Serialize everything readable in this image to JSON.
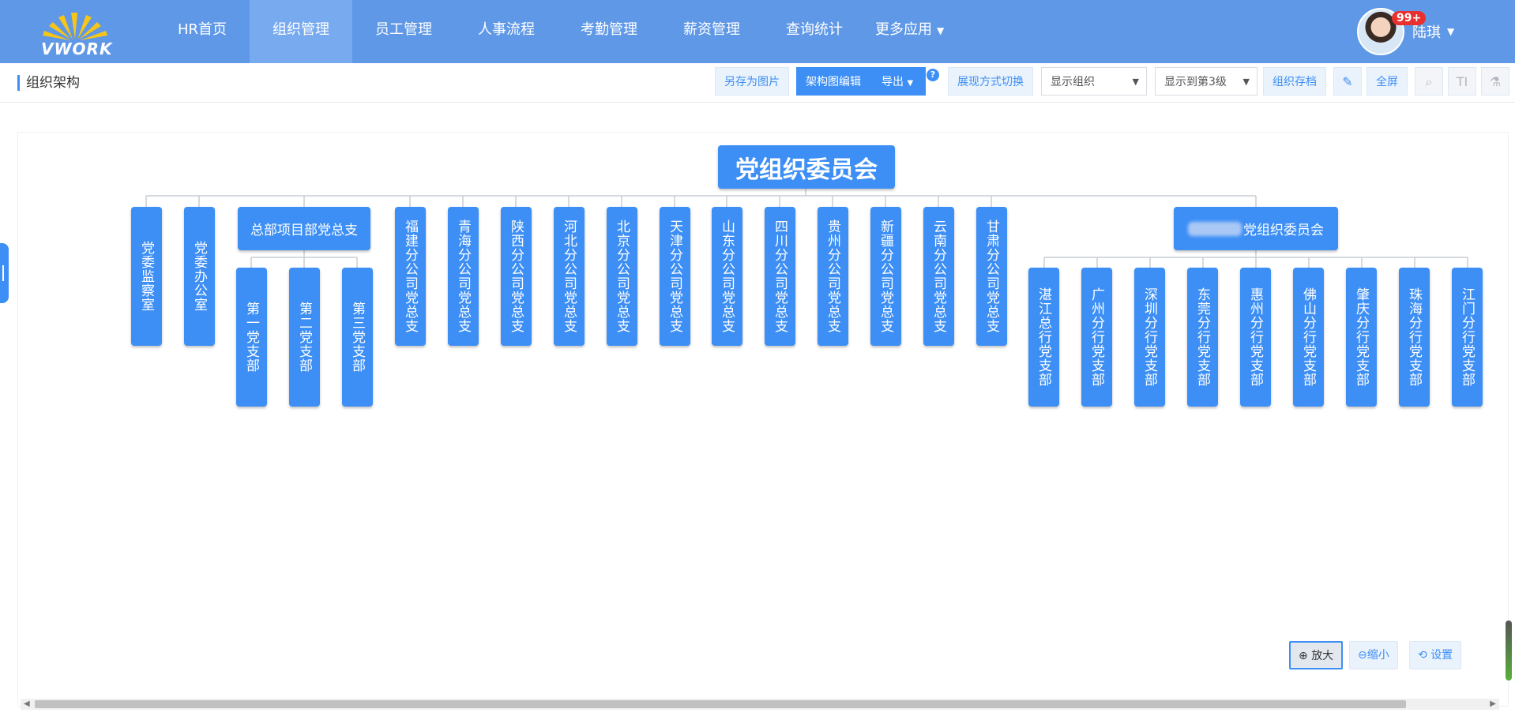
{
  "app": {
    "logo_text": "VWORK"
  },
  "nav": {
    "items": [
      {
        "label": "HR首页"
      },
      {
        "label": "组织管理",
        "active": true
      },
      {
        "label": "员工管理"
      },
      {
        "label": "人事流程"
      },
      {
        "label": "考勤管理"
      },
      {
        "label": "薪资管理"
      },
      {
        "label": "查询统计"
      },
      {
        "label": "更多应用"
      }
    ]
  },
  "user": {
    "name": "陆琪",
    "badge": "99+"
  },
  "page": {
    "title": "组织架构"
  },
  "toolbar": {
    "save_image": "另存为图片",
    "edit_chart": "架构图编辑",
    "export": "导出",
    "help": "?",
    "switch_view": "展现方式切换",
    "show_select": "显示组织",
    "level_select": "显示到第3级",
    "archive": "组织存档",
    "fullscreen": "全屏",
    "text_icon": "TI"
  },
  "chart": {
    "root": "党组织委员会",
    "level2": [
      "党委监察室",
      "党委办公室",
      "总部项目部党总支",
      "福建分公司党总支",
      "青海分公司党总支",
      "陕西分公司党总支",
      "河北分公司党总支",
      "北京分公司党总支",
      "天津分公司党总支",
      "山东分公司党总支",
      "四川分公司党总支",
      "贵州分公司党总支",
      "新疆分公司党总支",
      "云南分公司党总支",
      "甘肃分公司党总支",
      "党组织委员会"
    ],
    "hq_children": [
      "第一党支部",
      "第二党支部",
      "第三党支部"
    ],
    "sub_children": [
      "湛江总行党支部",
      "广州分行党支部",
      "深圳分行党支部",
      "东莞分行党支部",
      "惠州分行党支部",
      "佛山分行党支部",
      "肇庆分行党支部",
      "珠海分行党支部",
      "江门分行党支部"
    ]
  },
  "zoom": {
    "in": "放大",
    "out": "缩小",
    "settings": "设置"
  }
}
